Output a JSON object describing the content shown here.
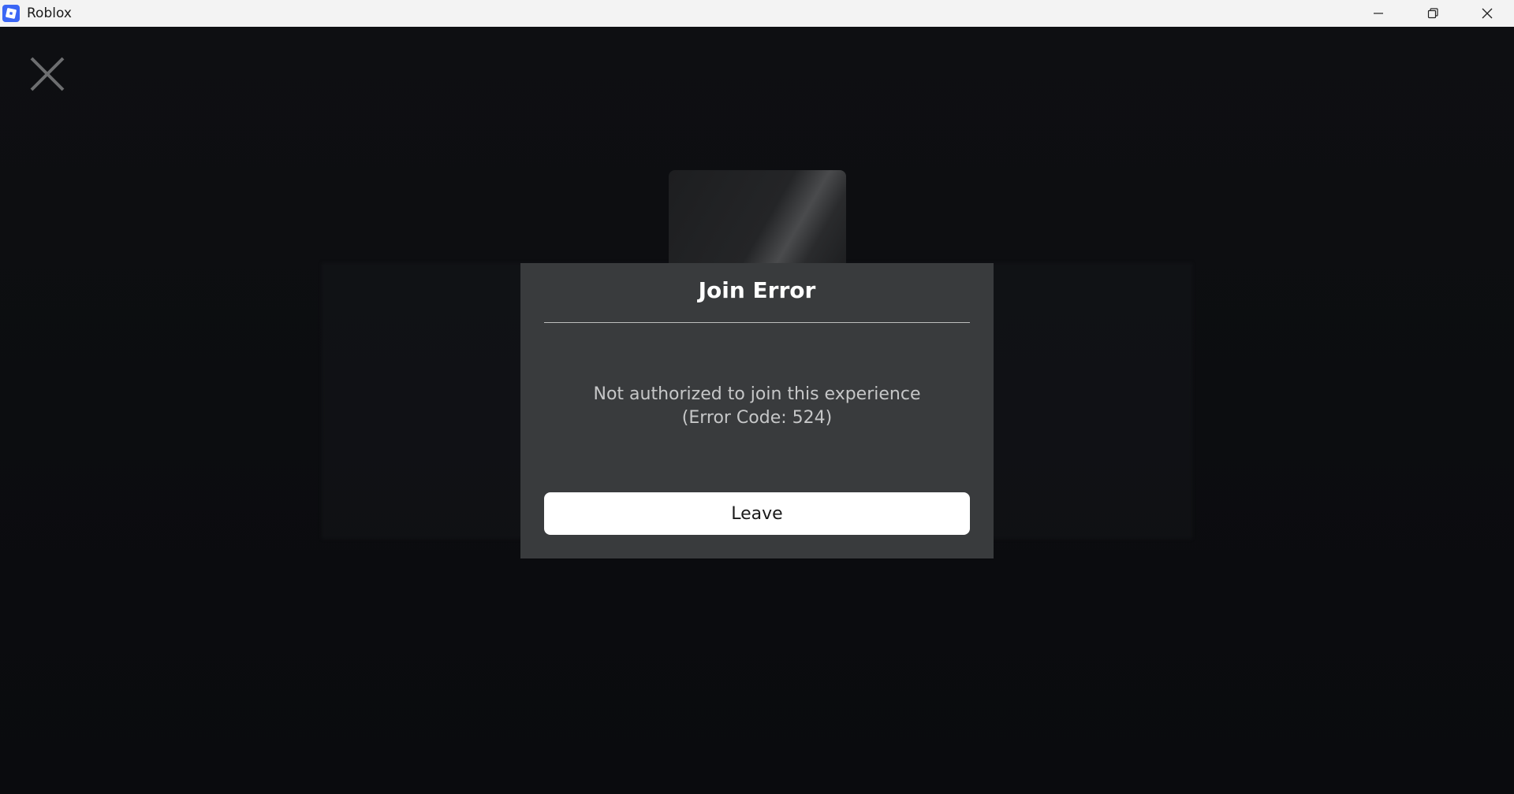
{
  "window": {
    "title": "Roblox",
    "app_icon": "roblox-icon",
    "controls": [
      "minimize-icon",
      "restore-icon",
      "close-icon"
    ]
  },
  "overlay": {
    "close_icon": "close-icon"
  },
  "dialog": {
    "title": "Join Error",
    "message_line1": "Not authorized to join this experience",
    "message_line2": "(Error Code: 524)",
    "button_label": "Leave"
  },
  "colors": {
    "background": "#0d0e11",
    "dialog_bg": "#393b3d",
    "button_bg": "#ffffff",
    "app_icon": "#3b66f5"
  }
}
